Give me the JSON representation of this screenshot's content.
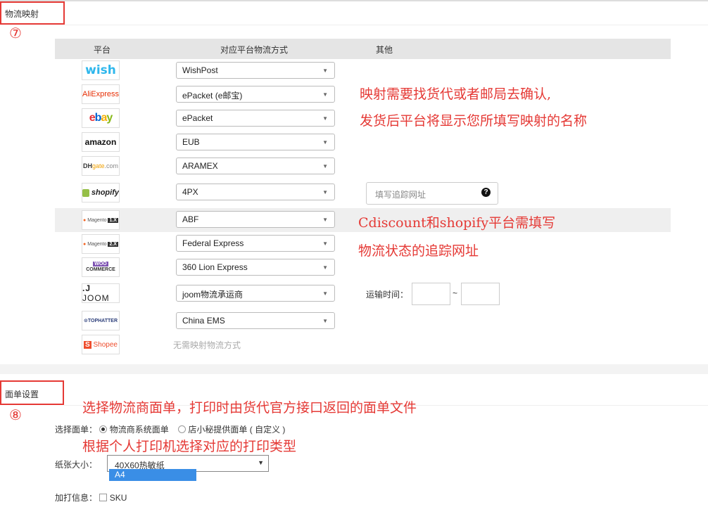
{
  "section1": {
    "title": "物流映射",
    "num": "⑦"
  },
  "table": {
    "headers": {
      "platform": "平台",
      "method": "对应平台物流方式",
      "other": "其他"
    },
    "rows": [
      {
        "logo": "wish",
        "value": "WishPost",
        "icon": "wish-logo-icon"
      },
      {
        "logo": "AliExpress",
        "value": "ePacket (e邮宝)",
        "icon": "aliexpress-logo-icon"
      },
      {
        "logo": "ebay",
        "value": "ePacket",
        "icon": "ebay-logo-icon"
      },
      {
        "logo": "amazon",
        "value": "EUB",
        "icon": "amazon-logo-icon"
      },
      {
        "logo": "DHgate.com",
        "value": "ARAMEX",
        "icon": "dhgate-logo-icon"
      },
      {
        "logo": "shopify",
        "value": "4PX",
        "icon": "shopify-logo-icon"
      },
      {
        "logo": "Magento 1.x",
        "value": "ABF",
        "icon": "magento1-logo-icon"
      },
      {
        "logo": "Magento 2.x",
        "value": "Federal Express",
        "icon": "magento2-logo-icon"
      },
      {
        "logo": "WOO COMMERCE",
        "value": "360 Lion Express",
        "icon": "woocommerce-logo-icon"
      },
      {
        "logo": "JOOM",
        "value": "joom物流承运商",
        "icon": "joom-logo-icon"
      },
      {
        "logo": "TOPHATTER",
        "value": "China EMS",
        "icon": "tophatter-logo-icon"
      },
      {
        "logo": "Shopee",
        "value": "无需映射物流方式",
        "icon": "shopee-logo-icon"
      }
    ],
    "tracking_placeholder": "填写追踪网址",
    "transit_label": "运输时间：",
    "transit_sep": "~"
  },
  "notes": {
    "n1": "映射需要找货代或者邮局去确认,",
    "n2": "发货后平台将显示您所填写映射的名称",
    "n3": "Cdiscount和shopify平台需填写",
    "n4": "物流状态的追踪网址",
    "n5": "选择物流商面单，打印时由货代官方接口返回的面单文件",
    "n6": "根据个人打印机选择对应的打印类型"
  },
  "section2": {
    "title": "面单设置",
    "num": "⑧",
    "label_select": "选择面单：",
    "opt1": "物流商系统面单",
    "opt2": "店小秘提供面单 ( 自定义 )",
    "paper_label": "纸张大小：",
    "paper_value": "40X60热敏纸",
    "paper_option": "A4",
    "extra_label": "加打信息：",
    "extra_sku": "SKU"
  },
  "colors": {
    "accent": "#e53935",
    "highlight": "#3a8ee6"
  }
}
